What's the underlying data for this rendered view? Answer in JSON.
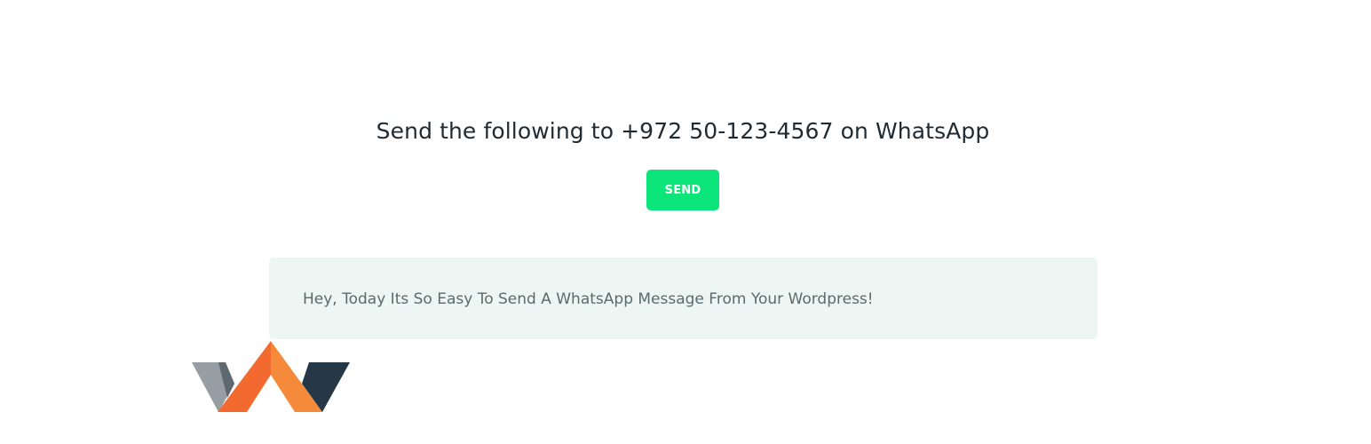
{
  "heading": {
    "text": "Send the following to +972 50-123-4567 on WhatsApp"
  },
  "send_button": {
    "label": "SEND"
  },
  "message": {
    "text": "Hey, Today Its So Easy To Send A WhatsApp Message From Your Wordpress!"
  },
  "colors": {
    "button_bg": "#0ce57a",
    "message_bg": "#edf6f2",
    "heading_text": "#1f2a33",
    "message_text": "#596b6e",
    "logo_orange": "#f36a30",
    "logo_light_orange": "#f48a3a",
    "logo_gray": "#979ea3",
    "logo_dark": "#263845"
  },
  "logo": {
    "icon": "w-logo-icon"
  }
}
